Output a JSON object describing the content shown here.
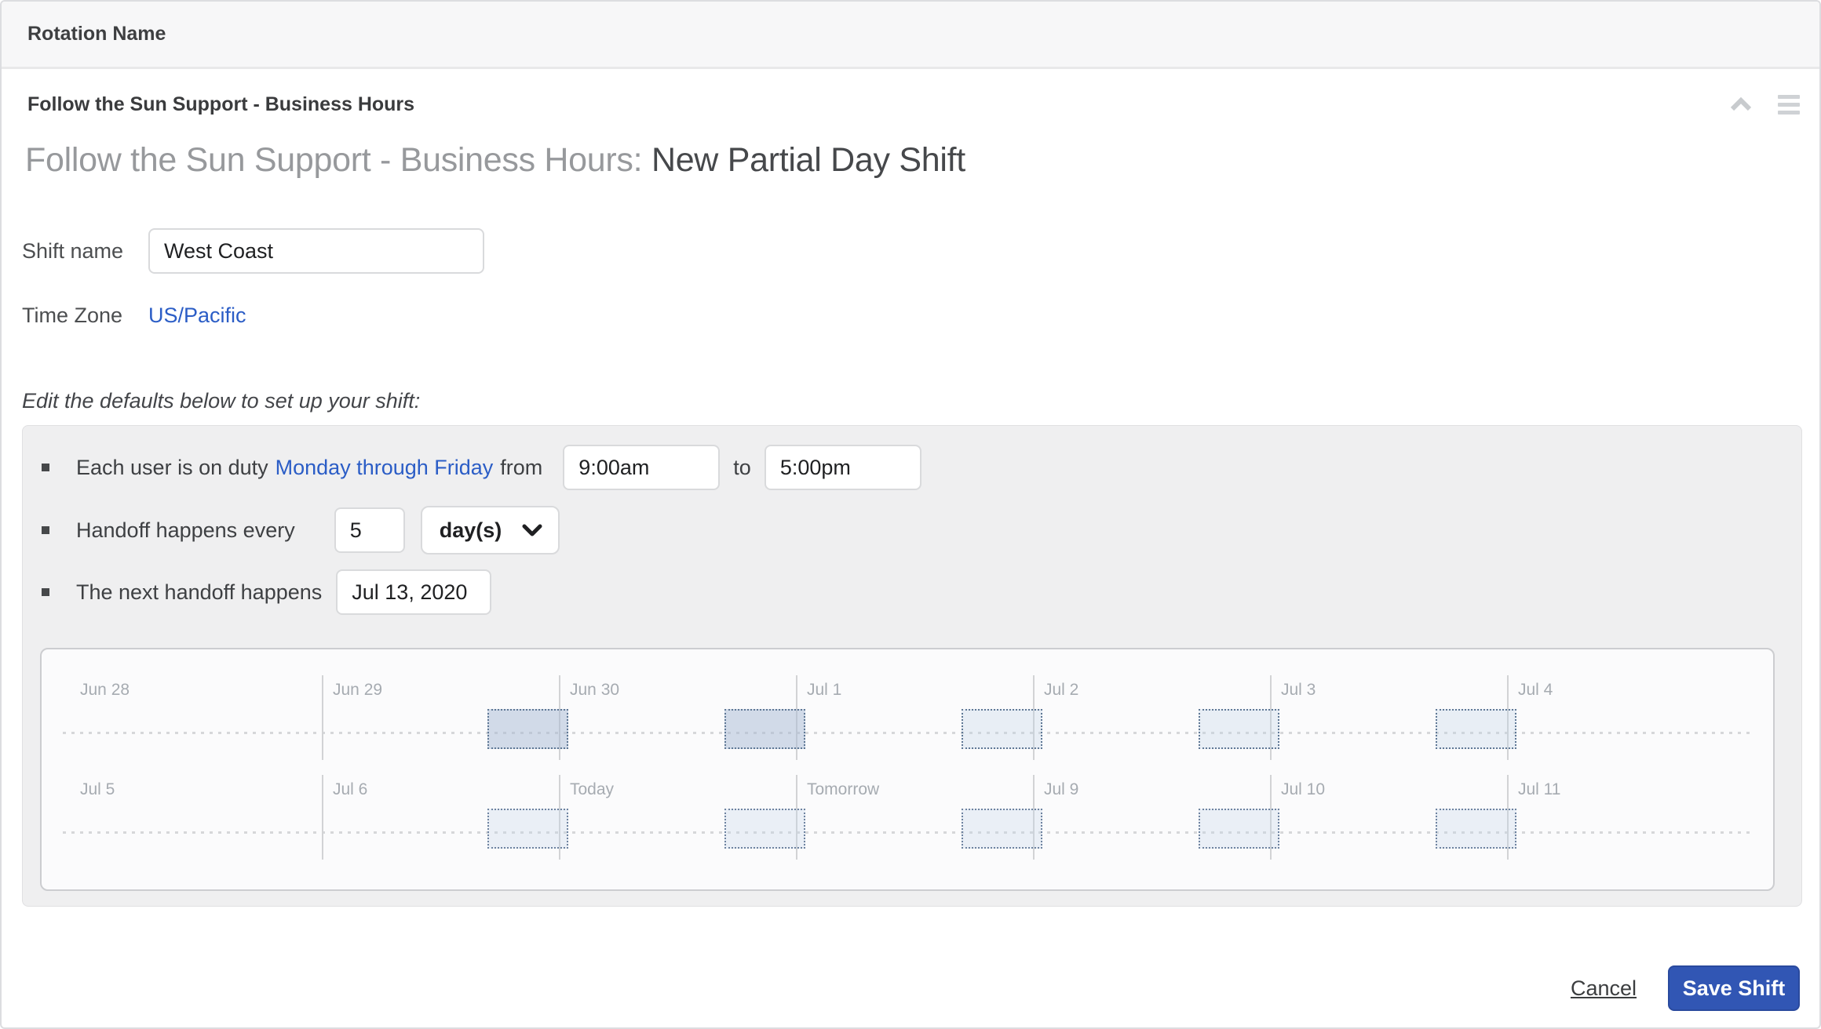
{
  "header": {
    "title": "Rotation Name"
  },
  "rotation": {
    "name": "Follow the Sun Support - Business Hours",
    "page_title_prefix": "Follow the Sun Support - Business Hours:",
    "page_title_suffix": "New Partial Day Shift"
  },
  "icons": {
    "collapse": "chevron-up-icon",
    "menu": "hamburger-menu-icon",
    "select_caret": "chevron-down-icon"
  },
  "form": {
    "shift_name_label": "Shift name",
    "shift_name_value": "West Coast",
    "timezone_label": "Time Zone",
    "timezone_value": "US/Pacific",
    "edit_hint": "Edit the defaults below to set up your shift:",
    "duty_rule": {
      "prefix": "Each user is on duty",
      "days_link": "Monday through Friday",
      "from_word": "from",
      "start_time": "9:00am",
      "to_word": "to",
      "end_time": "5:00pm"
    },
    "handoff_rule": {
      "label": "Handoff happens every",
      "interval_value": "5",
      "unit_value": "day(s)"
    },
    "next_handoff": {
      "label": "The next handoff happens",
      "date_value": "Jul 13, 2020"
    }
  },
  "timeline": {
    "rows": [
      {
        "days": [
          "Jun 28",
          "Jun 29",
          "Jun 30",
          "Jul 1",
          "Jul 2",
          "Jul 3",
          "Jul 4"
        ],
        "shift_blocks": [
          {
            "day_index": 2,
            "shade": "dark"
          },
          {
            "day_index": 3,
            "shade": "dark"
          },
          {
            "day_index": 4,
            "shade": "light"
          },
          {
            "day_index": 5,
            "shade": "light"
          },
          {
            "day_index": 6,
            "shade": "light"
          }
        ]
      },
      {
        "days": [
          "Jul 5",
          "Jul 6",
          "Today",
          "Tomorrow",
          "Jul 9",
          "Jul 10",
          "Jul 11"
        ],
        "shift_blocks": [
          {
            "day_index": 2,
            "shade": "row2"
          },
          {
            "day_index": 3,
            "shade": "row2"
          },
          {
            "day_index": 4,
            "shade": "row2"
          },
          {
            "day_index": 5,
            "shade": "row2"
          },
          {
            "day_index": 6,
            "shade": "row2"
          }
        ]
      }
    ]
  },
  "footer": {
    "cancel_label": "Cancel",
    "save_label": "Save Shift"
  },
  "colors": {
    "link_blue": "#2b5dc6",
    "save_button_blue": "#3156b4",
    "panel_gray": "#efeff0",
    "shift_block_dark": "#d4dde8",
    "shift_block_light": "#e9eff6",
    "shift_block_border": "#5f7895",
    "timeline_label_gray": "#a6abb1"
  }
}
